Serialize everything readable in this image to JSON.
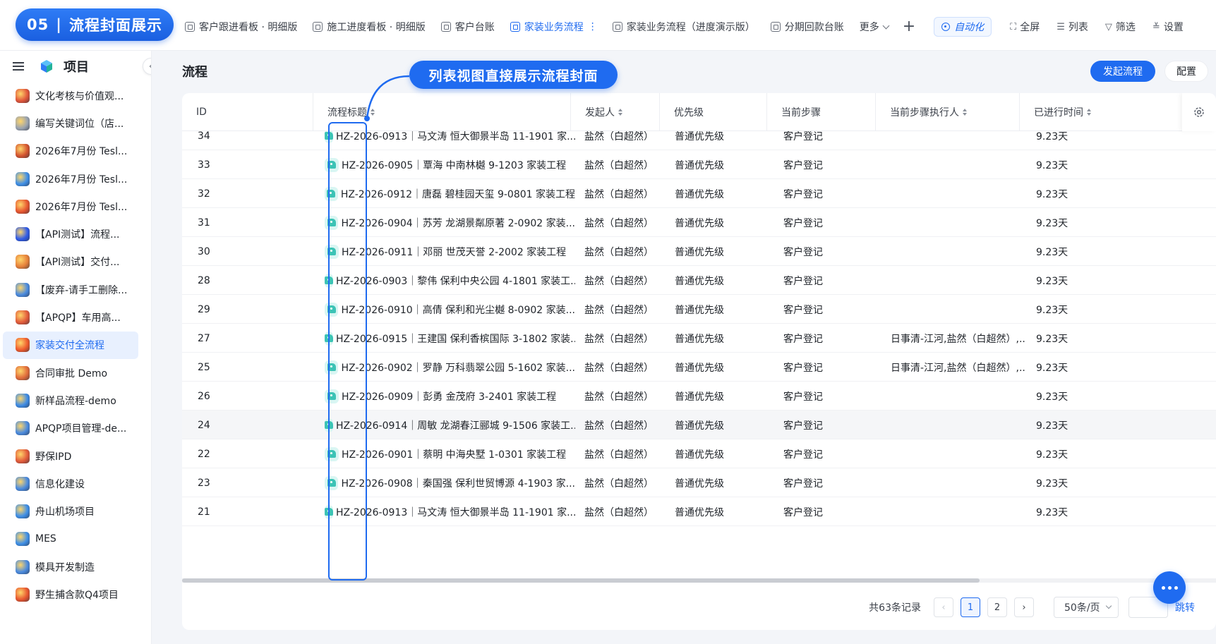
{
  "badge": {
    "number": "05",
    "separator": "|",
    "title": "流程封面展示"
  },
  "tabs": [
    {
      "label": "客户跟进看板 · 明细版",
      "active": false
    },
    {
      "label": "施工进度看板 · 明细版",
      "active": false
    },
    {
      "label": "客户台账",
      "active": false
    },
    {
      "label": "家装业务流程",
      "active": true,
      "more": "⋮"
    },
    {
      "label": "家装业务流程（进度演示版）",
      "active": false
    },
    {
      "label": "分期回款台账",
      "active": false
    }
  ],
  "toolbar": {
    "more": "更多",
    "add": "+",
    "automation": "自动化",
    "fullscreen": "全屏",
    "list": "列表",
    "filter": "筛选",
    "settings": "设置"
  },
  "sidebar": {
    "title": "项目",
    "items": [
      {
        "label": "文化考核与价值观...",
        "active": false,
        "color": "#e0553a"
      },
      {
        "label": "编写关键词位（店...",
        "active": false,
        "color": "#9aa3b0"
      },
      {
        "label": "2026年7月份 Tesl...",
        "active": false,
        "color": "#d3532f"
      },
      {
        "label": "2026年7月份 Tesl...",
        "active": false,
        "color": "#3e8fe8"
      },
      {
        "label": "2026年7月份 Tesl...",
        "active": false,
        "color": "#e7552f"
      },
      {
        "label": "【API测试】流程...",
        "active": false,
        "color": "#2f5be8"
      },
      {
        "label": "【API测试】交付...",
        "active": false,
        "color": "#e6803a"
      },
      {
        "label": "【废弃-请手工删除...",
        "active": false,
        "color": "#4a8be0"
      },
      {
        "label": "【APQP】车用高...",
        "active": false,
        "color": "#e25a3a"
      },
      {
        "label": "家装交付全流程",
        "active": true,
        "color": "#ef5a2c"
      },
      {
        "label": "合同审批 Demo",
        "active": false,
        "color": "#e06b3a"
      },
      {
        "label": "新样品流程-demo",
        "active": false,
        "color": "#3d8be6"
      },
      {
        "label": "APQP项目管理-de...",
        "active": false,
        "color": "#4a8be0"
      },
      {
        "label": "野保IPD",
        "active": false,
        "color": "#e25a3a"
      },
      {
        "label": "信息化建设",
        "active": false,
        "color": "#4a8be0"
      },
      {
        "label": "舟山机场项目",
        "active": false,
        "color": "#3e8fe8"
      },
      {
        "label": "MES",
        "active": false,
        "color": "#3e8fe8"
      },
      {
        "label": "模具开发制造",
        "active": false,
        "color": "#4a8be0"
      },
      {
        "label": "野生捕含款Q4项目",
        "active": false,
        "color": "#e7552f"
      }
    ]
  },
  "main": {
    "title": "流程",
    "start_button": "发起流程",
    "config_button": "配置"
  },
  "callout": "列表视图直接展示流程封面",
  "table": {
    "columns": [
      "ID",
      "流程标题",
      "发起人",
      "优先级",
      "当前步骤",
      "当前步骤执行人",
      "已进行时间"
    ],
    "rows": [
      {
        "id": "34",
        "title": "HZ-2026-0913｜马文涛 恒大御景半岛 11-1901 家...",
        "initiator": "盐然（白超然）",
        "priority": "普通优先级",
        "step": "客户登记",
        "executor": "",
        "elapsed": "9.23天"
      },
      {
        "id": "33",
        "title": "HZ-2026-0905｜覃海 中南林樾 9-1203 家装工程",
        "initiator": "盐然（白超然）",
        "priority": "普通优先级",
        "step": "客户登记",
        "executor": "",
        "elapsed": "9.23天"
      },
      {
        "id": "32",
        "title": "HZ-2026-0912｜唐磊 碧桂园天玺 9-0801 家装工程",
        "initiator": "盐然（白超然）",
        "priority": "普通优先级",
        "step": "客户登记",
        "executor": "",
        "elapsed": "9.23天"
      },
      {
        "id": "31",
        "title": "HZ-2026-0904｜苏芳 龙湖景粼原著 2-0902 家装...",
        "initiator": "盐然（白超然）",
        "priority": "普通优先级",
        "step": "客户登记",
        "executor": "",
        "elapsed": "9.23天"
      },
      {
        "id": "30",
        "title": "HZ-2026-0911｜邓丽 世茂天誉 2-2002 家装工程",
        "initiator": "盐然（白超然）",
        "priority": "普通优先级",
        "step": "客户登记",
        "executor": "",
        "elapsed": "9.23天"
      },
      {
        "id": "28",
        "title": "HZ-2026-0903｜黎伟 保利中央公园 4-1801 家装工...",
        "initiator": "盐然（白超然）",
        "priority": "普通优先级",
        "step": "客户登记",
        "executor": "",
        "elapsed": "9.23天"
      },
      {
        "id": "29",
        "title": "HZ-2026-0910｜高倩 保利和光尘樾 8-0902 家装...",
        "initiator": "盐然（白超然）",
        "priority": "普通优先级",
        "step": "客户登记",
        "executor": "",
        "elapsed": "9.23天"
      },
      {
        "id": "27",
        "title": "HZ-2026-0915｜王建国 保利香槟国际 3-1802 家装...",
        "initiator": "盐然（白超然）",
        "priority": "普通优先级",
        "step": "客户登记",
        "executor": "日事清-江河,盐然（白超然）,...",
        "elapsed": "9.23天"
      },
      {
        "id": "25",
        "title": "HZ-2026-0902｜罗静 万科翡翠公园 5-1602 家装...",
        "initiator": "盐然（白超然）",
        "priority": "普通优先级",
        "step": "客户登记",
        "executor": "日事清-江河,盐然（白超然）,...",
        "elapsed": "9.23天"
      },
      {
        "id": "26",
        "title": "HZ-2026-0909｜彭勇 金茂府 3-2401 家装工程",
        "initiator": "盐然（白超然）",
        "priority": "普通优先级",
        "step": "客户登记",
        "executor": "",
        "elapsed": "9.23天"
      },
      {
        "id": "24",
        "title": "HZ-2026-0914｜周敏 龙湖春江郦城 9-1506 家装工...",
        "initiator": "盐然（白超然）",
        "priority": "普通优先级",
        "step": "客户登记",
        "executor": "",
        "elapsed": "9.23天",
        "highlight": true
      },
      {
        "id": "22",
        "title": "HZ-2026-0901｜蔡明 中海央墅 1-0301 家装工程",
        "initiator": "盐然（白超然）",
        "priority": "普通优先级",
        "step": "客户登记",
        "executor": "",
        "elapsed": "9.23天"
      },
      {
        "id": "23",
        "title": "HZ-2026-0908｜秦国强 保利世贸博源 4-1903 家...",
        "initiator": "盐然（白超然）",
        "priority": "普通优先级",
        "step": "客户登记",
        "executor": "",
        "elapsed": "9.23天"
      },
      {
        "id": "21",
        "title": "HZ-2026-0913｜马文涛 恒大御景半岛 11-1901 家...",
        "initiator": "盐然（白超然）",
        "priority": "普通优先级",
        "step": "客户登记",
        "executor": "",
        "elapsed": "9.23天"
      }
    ]
  },
  "pagination": {
    "total": "共63条记录",
    "prev": "‹",
    "pages": [
      "1",
      "2"
    ],
    "current": "1",
    "next": "›",
    "page_size": "50条/页",
    "jump": "跳转"
  },
  "colors": {
    "accent": "#1f6bf0",
    "cover_bg": "#d9f6f3",
    "cover_icon": "#3cc3b6"
  }
}
